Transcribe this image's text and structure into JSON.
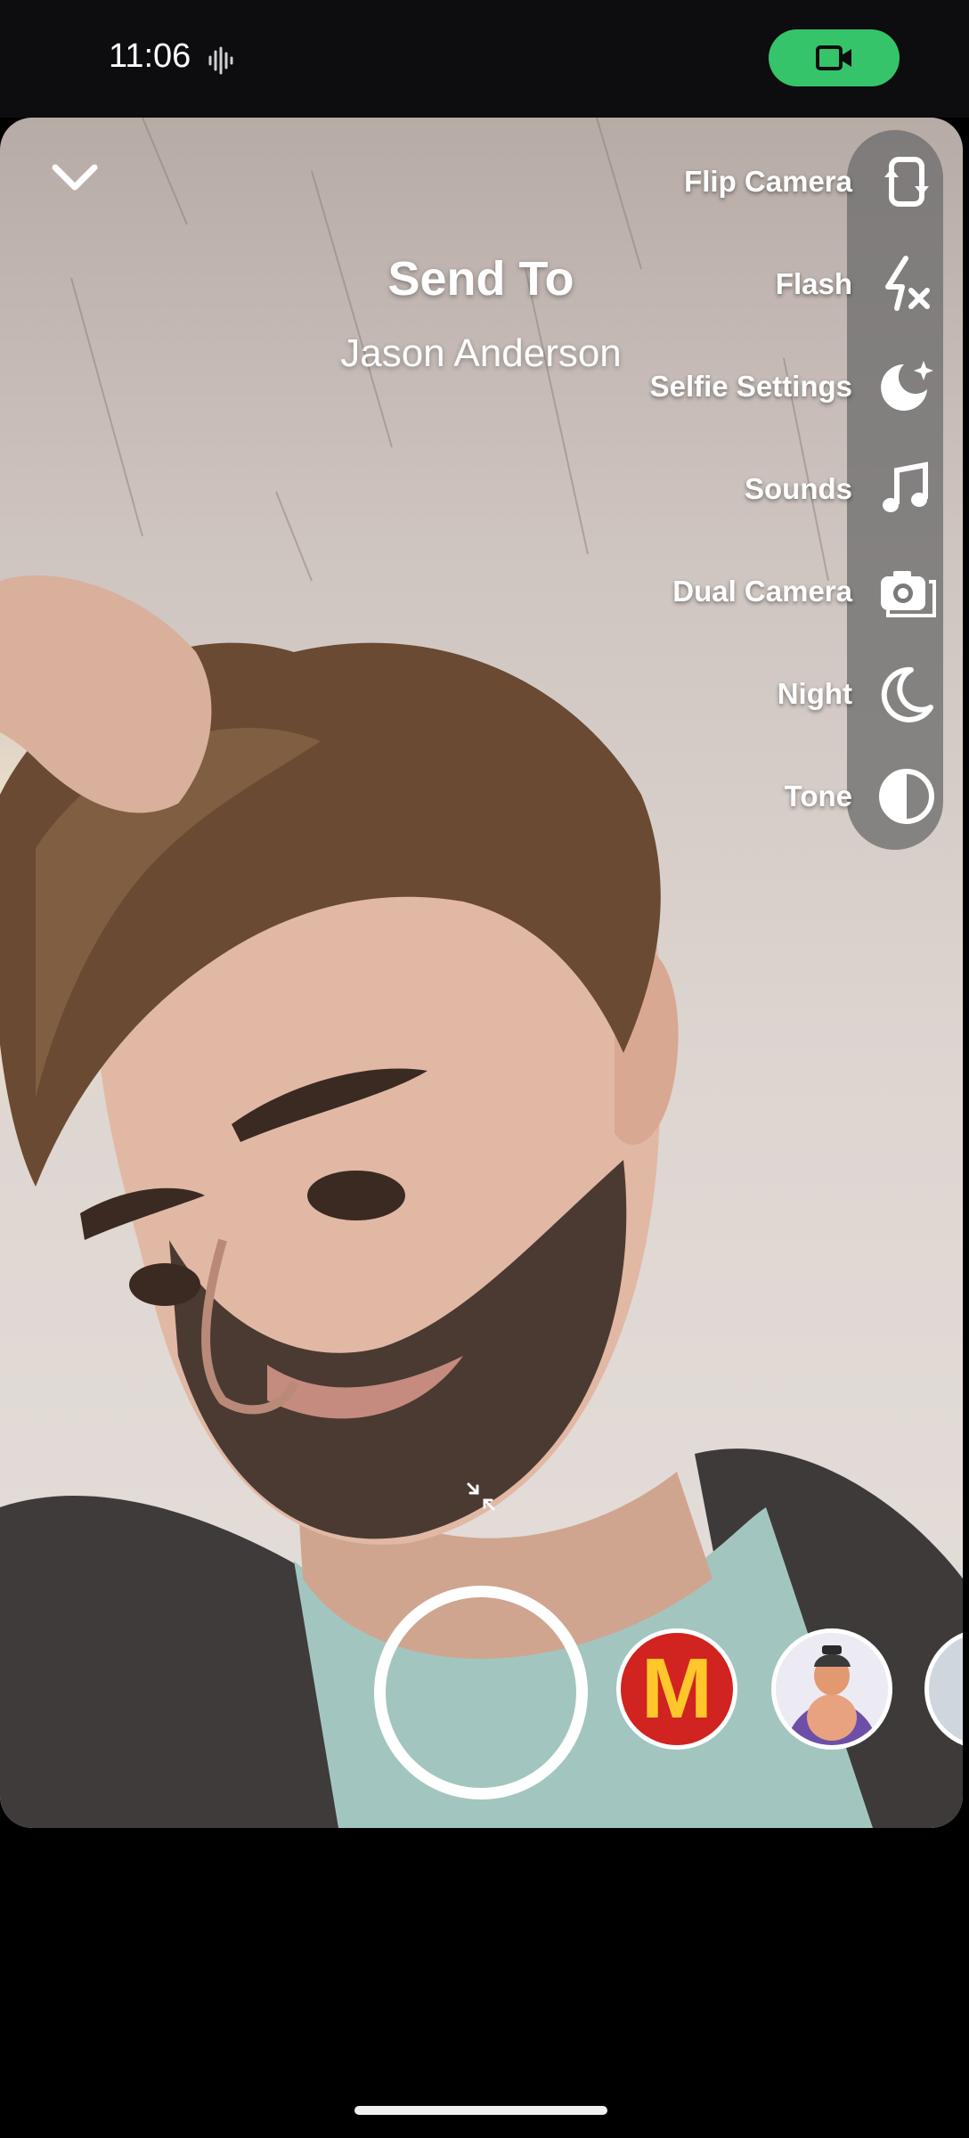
{
  "status_bar": {
    "time": "11:06",
    "audio_icon": "sound-wave-icon",
    "video_icon": "video-camera-icon",
    "accent_color": "#35c46a"
  },
  "header": {
    "collapse_icon": "chevron-down-icon",
    "title": "Send To",
    "recipient": "Jason Anderson"
  },
  "tools": [
    {
      "label": "Flip Camera",
      "icon": "flip-camera-icon"
    },
    {
      "label": "Flash",
      "icon": "flash-off-icon"
    },
    {
      "label": "Selfie Settings",
      "icon": "selfie-settings-icon"
    },
    {
      "label": "Sounds",
      "icon": "music-note-icon"
    },
    {
      "label": "Dual Camera",
      "icon": "dual-camera-icon"
    },
    {
      "label": "Night",
      "icon": "moon-icon"
    },
    {
      "label": "Tone",
      "icon": "tone-icon"
    }
  ],
  "capture": {
    "shutter_icon": "shutter-button",
    "lenses": [
      {
        "name": "mcdonalds-lens",
        "text": "M",
        "color": "#d1231f"
      },
      {
        "name": "character-lens"
      },
      {
        "name": "partial-lens"
      }
    ]
  }
}
